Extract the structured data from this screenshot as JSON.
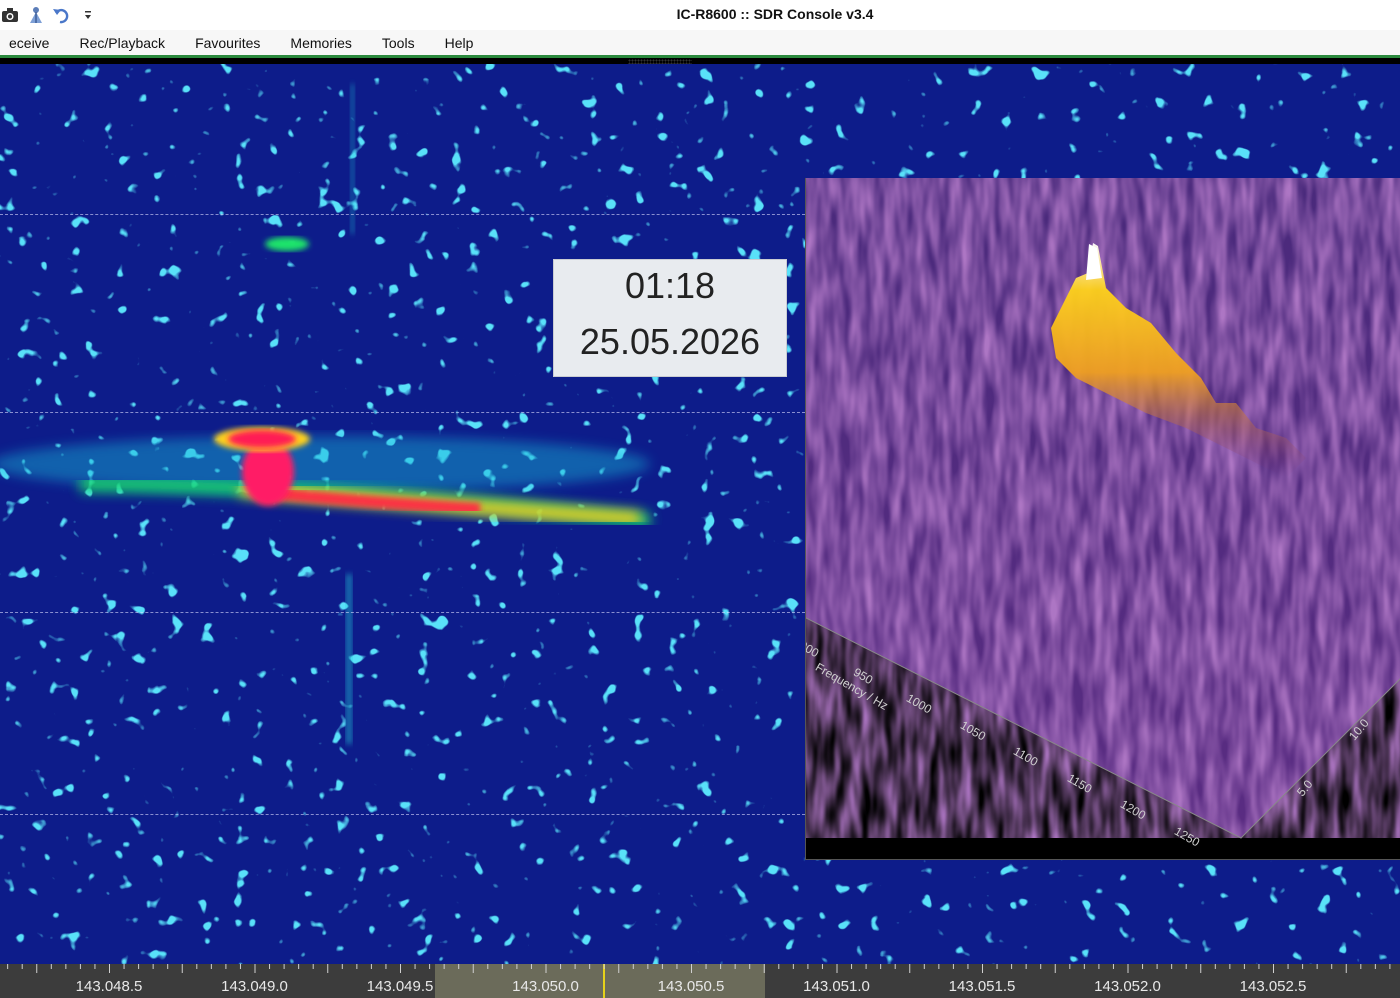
{
  "window": {
    "title": "IC-R8600 :: SDR Console v3.4"
  },
  "quick_access": [
    {
      "name": "camera-icon"
    },
    {
      "name": "antenna-icon"
    },
    {
      "name": "undo-icon"
    },
    {
      "name": "customize-dropdown-icon"
    }
  ],
  "menu": {
    "items": [
      "eceive",
      "Rec/Playback",
      "Favourites",
      "Memories",
      "Tools",
      "Help"
    ]
  },
  "timestamp": {
    "time": "01:18",
    "date": "25.05.2026"
  },
  "inset_3d": {
    "frequency_axis_label": "Frequency / Hz",
    "frequency_ticks": [
      "900",
      "950",
      "1000",
      "1050",
      "1100",
      "1150",
      "1200",
      "1250"
    ],
    "time_ticks": [
      "5.0",
      "10.0"
    ]
  },
  "frequency_scale": {
    "labels": [
      "143.048.5",
      "143.049.0",
      "143.049.5",
      "143.050.0",
      "143.050.5",
      "143.051.0",
      "143.051.5",
      "143.052.0",
      "143.052.5"
    ]
  },
  "colors": {
    "waterfall_bg": "#0b1f8a",
    "signal_hot": "#ff1a55",
    "accent_green": "#2b8a3e",
    "center_marker": "#e6d21b"
  }
}
